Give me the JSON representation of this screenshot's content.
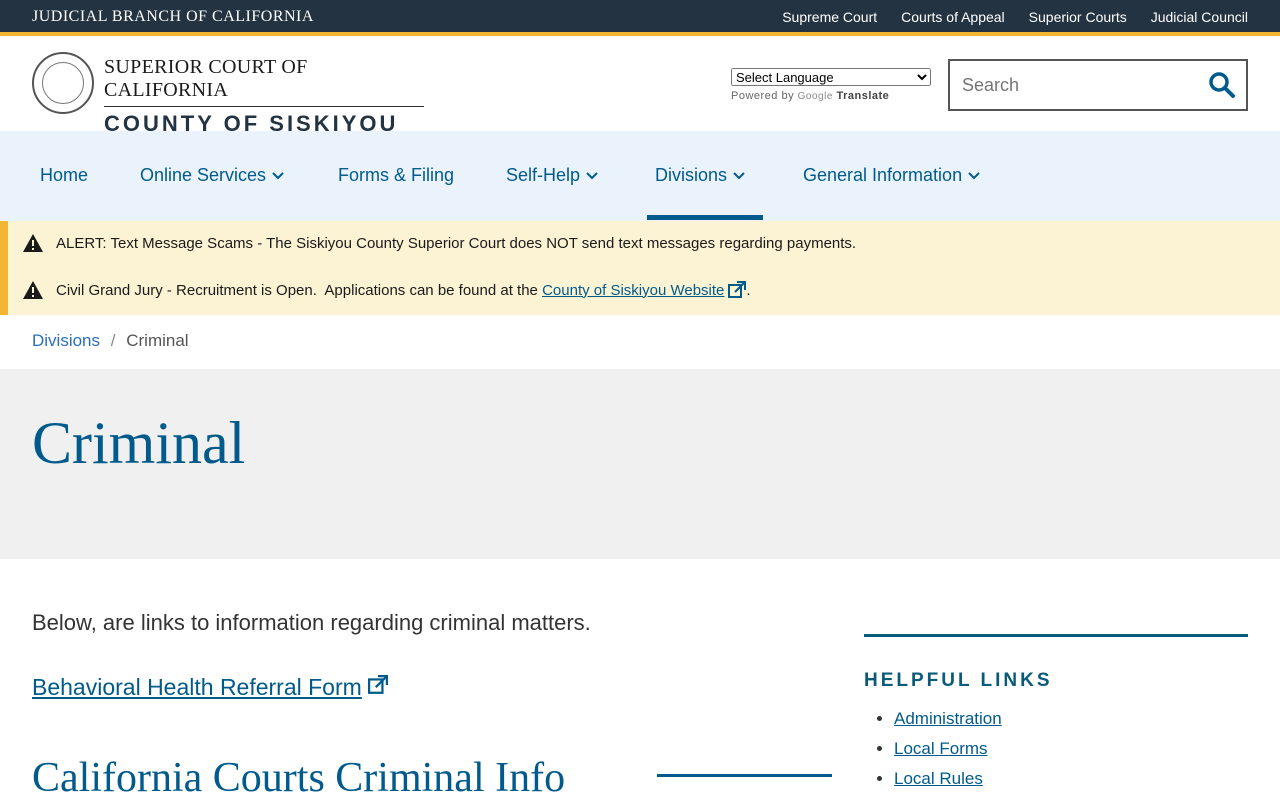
{
  "topbar": {
    "brand": "JUDICIAL BRANCH OF CALIFORNIA",
    "links": [
      "Supreme Court",
      "Courts of Appeal",
      "Superior Courts",
      "Judicial Council"
    ]
  },
  "header": {
    "line1": "SUPERIOR COURT OF CALIFORNIA",
    "line2": "COUNTY OF SISKIYOU",
    "translate": {
      "select": "Select Language",
      "powered_by": "Powered by",
      "google": "Google",
      "translate": "Translate"
    },
    "search": {
      "placeholder": "Search"
    }
  },
  "nav": {
    "items": [
      {
        "label": "Home",
        "has_menu": false
      },
      {
        "label": "Online Services",
        "has_menu": true
      },
      {
        "label": "Forms & Filing",
        "has_menu": false
      },
      {
        "label": "Self-Help",
        "has_menu": true
      },
      {
        "label": "Divisions",
        "has_menu": true,
        "active": true
      },
      {
        "label": "General Information",
        "has_menu": true
      }
    ]
  },
  "alerts": [
    {
      "text": "ALERT: Text Message Scams - The Siskiyou County Superior Court does NOT send text messages regarding payments."
    },
    {
      "text_before": "Civil Grand Jury - Recruitment is Open.  Applications can be found at the ",
      "link": "County of Siskiyou Website",
      "text_after": "."
    }
  ],
  "breadcrumb": {
    "parent": "Divisions",
    "separator": "/",
    "current": "Criminal"
  },
  "page": {
    "title": "Criminal",
    "intro": "Below, are links to information regarding criminal matters.",
    "link": "Behavioral Health Referral Form",
    "section_heading": "California Courts Criminal Info"
  },
  "sidebar": {
    "heading": "HELPFUL LINKS",
    "links": [
      "Administration",
      "Local Forms",
      "Local Rules"
    ]
  },
  "colors": {
    "primary": "#005a8c",
    "topbar": "#233342",
    "accent": "#f2b632",
    "alert_bg": "#fbf3d3",
    "nav_bg": "#eaf3fb"
  }
}
